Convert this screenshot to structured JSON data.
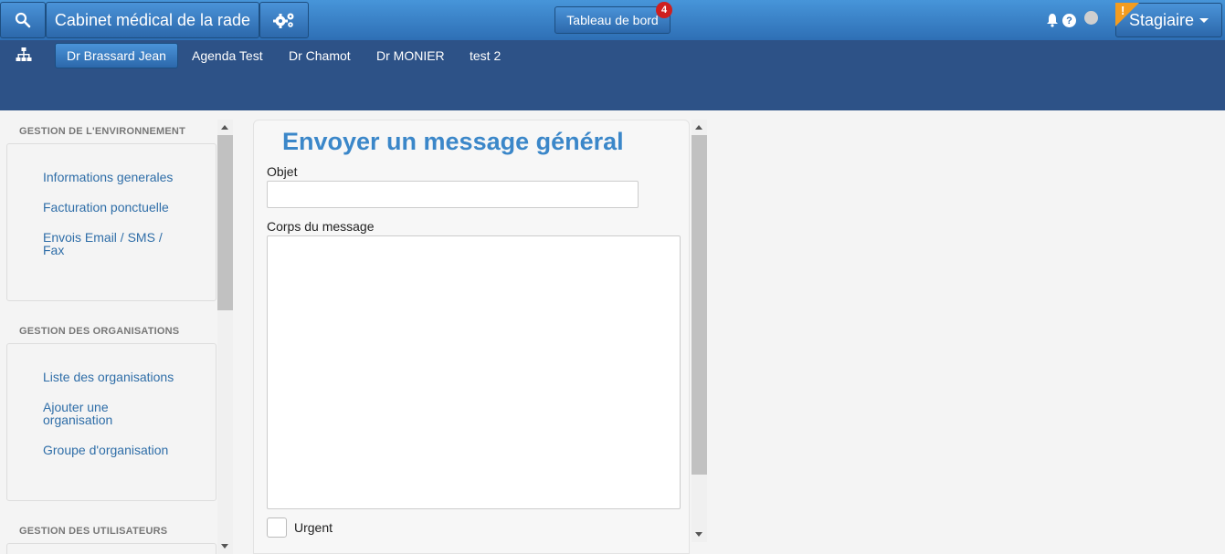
{
  "topbar": {
    "brand_label": "Cabinet médical de la rade",
    "dashboard_label": "Tableau de bord",
    "dashboard_badge": "4",
    "help_glyph": "?",
    "warning_glyph": "!",
    "user_label": "Stagiaire",
    "icons": [
      "search-icon",
      "gears-icon",
      "bell-icon",
      "help-icon",
      "status-dot",
      "warning-icon",
      "caret-down-icon"
    ]
  },
  "nav": {
    "tabs": [
      {
        "label": "Dr Brassard Jean",
        "active": true
      },
      {
        "label": "Agenda Test"
      },
      {
        "label": "Dr Chamot"
      },
      {
        "label": "Dr MONIER"
      },
      {
        "label": "test 2"
      }
    ]
  },
  "sidebar": {
    "sections": [
      {
        "title": "GESTION DE L'ENVIRONNEMENT",
        "items": [
          "Informations generales",
          "Facturation ponctuelle",
          "Envois Email / SMS / Fax"
        ]
      },
      {
        "title": "GESTION DES ORGANISATIONS",
        "items": [
          "Liste des organisations",
          "Ajouter une organisation",
          "Groupe d'organisation"
        ]
      },
      {
        "title": "GESTION DES UTILISATEURS",
        "items": []
      }
    ]
  },
  "form": {
    "title": "Envoyer un message général",
    "objet_label": "Objet",
    "objet_value": "",
    "corps_label": "Corps du message",
    "corps_value": "",
    "urgent_label": "Urgent",
    "urgent_checked": false
  },
  "colors": {
    "topbar": "#3b82c8",
    "navbar": "#2d5287",
    "accent": "#3b87c9",
    "link": "#2f6ea8",
    "badge": "#cf1f1f",
    "warning": "#f39c1f"
  }
}
